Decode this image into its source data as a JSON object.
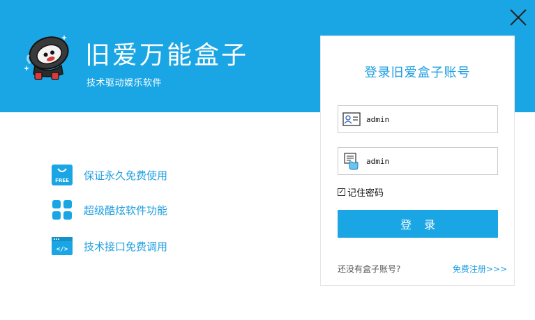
{
  "header": {
    "title": "旧爱万能盒子",
    "subtitle": "技术驱动娱乐软件",
    "mascot_icon": "ninja-mascot-icon",
    "close_icon": "close-icon"
  },
  "features": [
    {
      "icon": "free-bag-icon",
      "label": "保证永久免费使用",
      "icon_text": "FREE"
    },
    {
      "icon": "apps-grid-icon",
      "label": "超级酷炫软件功能"
    },
    {
      "icon": "code-window-icon",
      "label": "技术接口免费调用",
      "icon_text": "</>"
    }
  ],
  "login": {
    "title": "登录旧爱盒子账号",
    "username_value": "admin",
    "password_value": "admin",
    "username_icon": "id-card-icon",
    "password_icon": "password-card-icon",
    "remember_label": "记住密码",
    "remember_checked": true,
    "checkmark": "✓",
    "submit_label": "登录",
    "no_account_text": "还没有盒子账号?",
    "register_label": "免费注册>>>"
  },
  "colors": {
    "accent": "#1aa6e4",
    "link": "#1e9ee0",
    "background": "#ffffff"
  }
}
